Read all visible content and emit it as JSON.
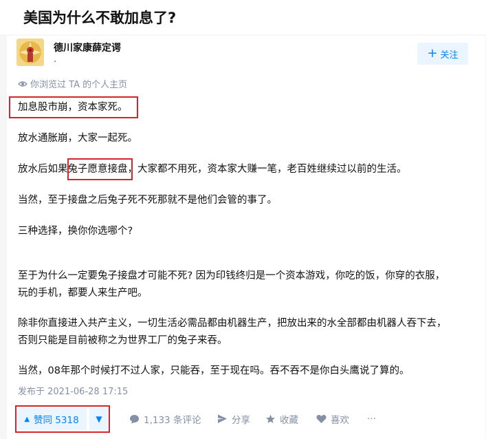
{
  "question": {
    "title": "美国为什么不敢加息了?"
  },
  "author": {
    "name": "德川家康薛定谔",
    "bio": "."
  },
  "follow": {
    "label": "关注"
  },
  "visit_note": "你浏览过 TA 的个人主页",
  "content": {
    "p1": "加息股市崩，资本家死。",
    "p2": "放水通胀崩，大家一起死。",
    "p3": "放水后如果兔子愿意接盘，大家都不用死，资本家大赚一笔，老百姓继续过以前的生活。",
    "p4": "当然，至于接盘之后兔子死不死那就不是他们会管的事了。",
    "p5": "三种选择，换你你选哪个?",
    "p6a": "至于为什么一定要兔子接盘才可能不死? 因为印钱终归是一个资本游戏，你吃的饭，你穿的衣服，",
    "p6b": "玩的手机，都要人来生产吧。",
    "p7a": "除非你直接进入共产主义，一切生活必需品都由机器生产，把放出来的水全部都由机器人吞下去，",
    "p7b": "否则只能是目前被称之为世界工厂的兔子来吞。",
    "p8": "当然，08年那个时候打不过人家，只能吞，至于现在吗。吞不吞不是你白头鹰说了算的。"
  },
  "publish_time": "发布于 2021-06-28 17:15",
  "actions": {
    "vote_up": "赞同 5318",
    "comments": "1,133 条评论",
    "share": "分享",
    "collect": "收藏",
    "like": "喜欢",
    "more": "···"
  },
  "colors": {
    "accent": "#0084ff",
    "accent_bg": "#ebf5ff",
    "muted": "#8590a6",
    "highlight_box": "#d8232a"
  }
}
